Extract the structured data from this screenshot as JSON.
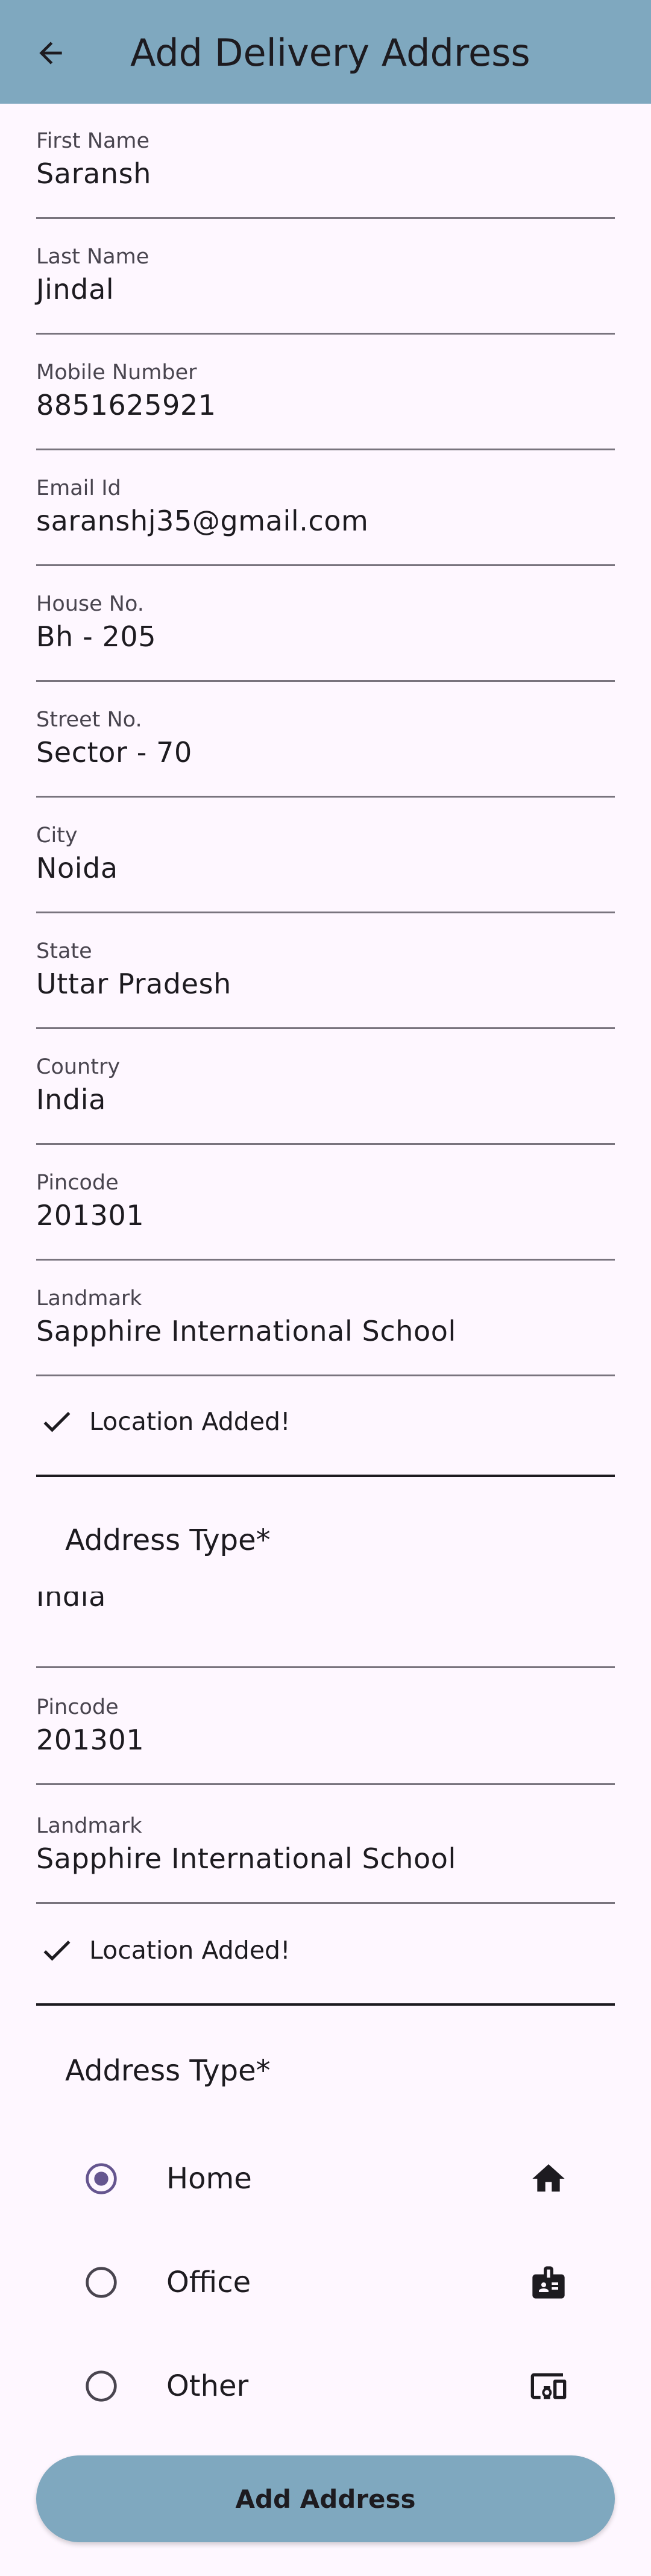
{
  "appbar": {
    "title": "Add Delivery Address",
    "back_icon": "arrow-left-icon"
  },
  "fields": [
    {
      "label": "First Name",
      "value": "Saransh"
    },
    {
      "label": "Last Name",
      "value": "Jindal"
    },
    {
      "label": "Mobile Number",
      "value": "8851625921"
    },
    {
      "label": "Email Id",
      "value": "saranshj35@gmail.com"
    },
    {
      "label": "House No.",
      "value": "Bh - 205"
    },
    {
      "label": "Street No.",
      "value": "Sector - 70"
    },
    {
      "label": "City",
      "value": "Noida"
    },
    {
      "label": "State",
      "value": "Uttar Pradesh"
    },
    {
      "label": "Country",
      "value": "India"
    },
    {
      "label": "Pincode",
      "value": "201301"
    },
    {
      "label": "Landmark",
      "value": "Sapphire International School"
    }
  ],
  "location_status": "Location Added!",
  "address_type_title": "Address Type*",
  "repeat": {
    "country_value": "India",
    "pincode": {
      "label": "Pincode",
      "value": "201301"
    },
    "landmark": {
      "label": "Landmark",
      "value": "Sapphire International School"
    },
    "location_status": "Location Added!",
    "address_type_title": "Address Type*"
  },
  "address_types": [
    {
      "label": "Home",
      "selected": true,
      "icon": "home-icon"
    },
    {
      "label": "Office",
      "selected": false,
      "icon": "badge-icon"
    },
    {
      "label": "Other",
      "selected": false,
      "icon": "devices-icon"
    }
  ],
  "submit_label": "Add Address",
  "colors": {
    "appbar": "#7FA8BF",
    "background": "#FEF7FF",
    "radio_selected": "#65558F",
    "button": "#7FA8BF"
  }
}
